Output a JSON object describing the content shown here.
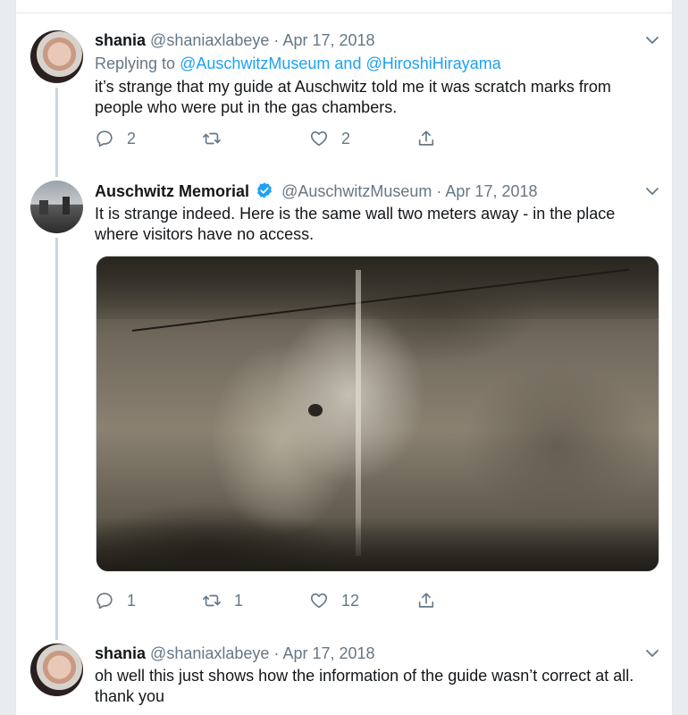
{
  "tweets": [
    {
      "name": "shania",
      "handle": "@shaniaxlabeye",
      "separator": "·",
      "date": "Apr 17, 2018",
      "replying_prefix": "Replying to",
      "replying_user1": "@AuschwitzMuseum",
      "replying_and": "and",
      "replying_user2": "@HiroshiHirayama",
      "text": "it’s strange that my guide at Auschwitz told me it was scratch marks from people who were put in the gas chambers.",
      "replies": "2",
      "retweets": "",
      "likes": "2"
    },
    {
      "name": "Auschwitz Memorial",
      "handle": "@AuschwitzMuseum",
      "separator": "·",
      "date": "Apr 17, 2018",
      "verified": true,
      "text": "It is strange indeed. Here is the same wall two meters away - in the place where visitors have no access.",
      "replies": "1",
      "retweets": "1",
      "likes": "12"
    },
    {
      "name": "shania",
      "handle": "@shaniaxlabeye",
      "separator": "·",
      "date": "Apr 17, 2018",
      "text": "oh well this just shows how the information of the guide wasn’t correct at all. thank you"
    }
  ],
  "colors": {
    "accent": "#1da1f2",
    "muted": "#657786",
    "text": "#14171a",
    "thread_line": "#ccd6dd"
  },
  "icons": [
    "reply-icon",
    "retweet-icon",
    "like-icon",
    "share-icon",
    "chevron-down-icon",
    "verified-badge-icon"
  ]
}
